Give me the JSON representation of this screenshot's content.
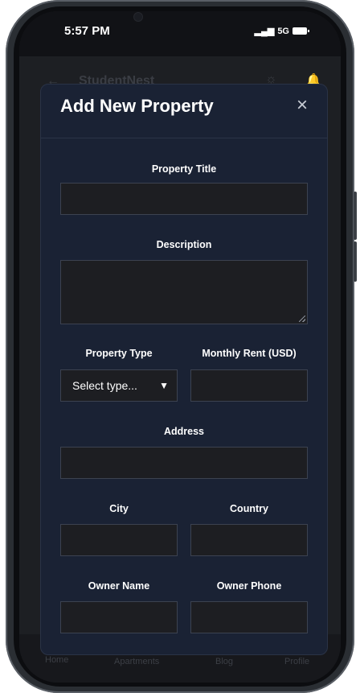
{
  "status_bar": {
    "time": "5:57 PM",
    "network": "5G"
  },
  "background_app": {
    "brand": "StudentNest",
    "nav": [
      {
        "label": "Home",
        "icon": "home-icon"
      },
      {
        "label": "Apartments",
        "icon": "location-icon"
      },
      {
        "label": "Blog",
        "icon": "book-icon"
      },
      {
        "label": "Profile",
        "icon": "user-icon"
      }
    ]
  },
  "modal": {
    "title": "Add New Property",
    "close_label": "×",
    "fields": {
      "property_title": {
        "label": "Property Title",
        "value": ""
      },
      "description": {
        "label": "Description",
        "value": ""
      },
      "property_type": {
        "label": "Property Type",
        "selected": "Select type..."
      },
      "monthly_rent": {
        "label": "Monthly Rent (USD)",
        "value": ""
      },
      "address": {
        "label": "Address",
        "value": ""
      },
      "city": {
        "label": "City",
        "value": ""
      },
      "country": {
        "label": "Country",
        "value": ""
      },
      "owner_name": {
        "label": "Owner Name",
        "value": ""
      },
      "owner_phone": {
        "label": "Owner Phone",
        "value": ""
      }
    }
  },
  "colors": {
    "modal_bg": "#1a2234",
    "field_bg": "#1d1e22",
    "field_border": "#3c4250",
    "text": "#ffffff"
  }
}
